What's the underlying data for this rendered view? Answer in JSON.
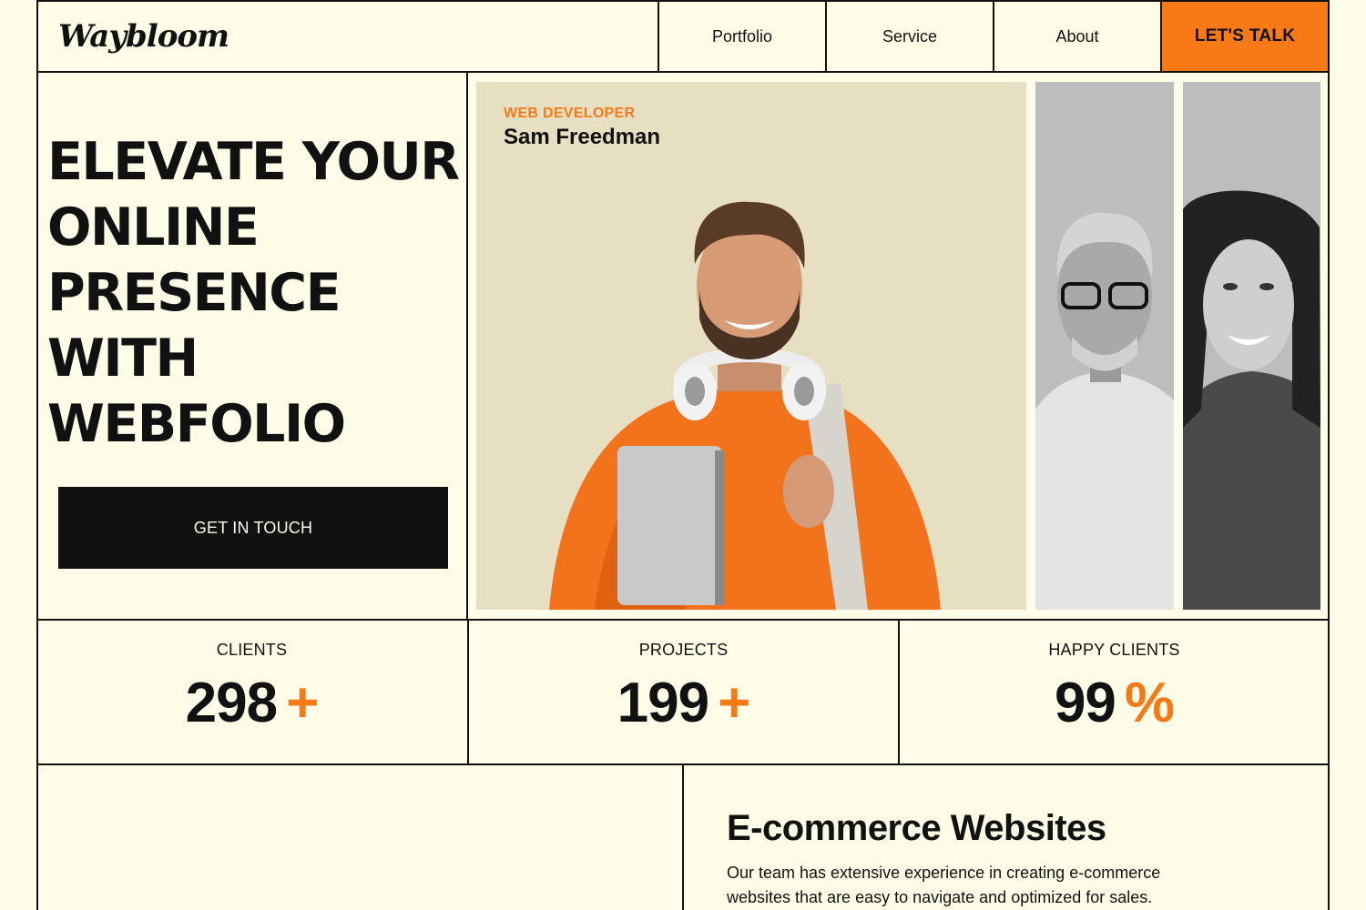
{
  "brand": {
    "logo_text": "Waybloom"
  },
  "nav": {
    "items": [
      "Portfolio",
      "Service",
      "About"
    ],
    "cta": "LET'S TALK"
  },
  "hero": {
    "headline_lines": [
      "ELEVATE YOUR",
      "ONLINE",
      "PRESENCE",
      "WITH",
      "WEBFOLIO"
    ],
    "button": "GET IN TOUCH",
    "featured": {
      "role": "WEB DEVELOPER",
      "name": "Sam Freedman"
    }
  },
  "stats": [
    {
      "label": "CLIENTS",
      "value": "298",
      "suffix": "+"
    },
    {
      "label": "PROJECTS",
      "value": "199",
      "suffix": "+"
    },
    {
      "label": "HAPPY CLIENTS",
      "value": "99",
      "suffix": "%"
    }
  ],
  "service": {
    "title": "E-commerce Websites",
    "description": "Our team has extensive experience in creating e-commerce websites that are easy to navigate and optimized for sales."
  },
  "colors": {
    "accent": "#F77A17",
    "background": "#FFFCE8",
    "ink": "#111111",
    "card": "#E6DFC2"
  }
}
